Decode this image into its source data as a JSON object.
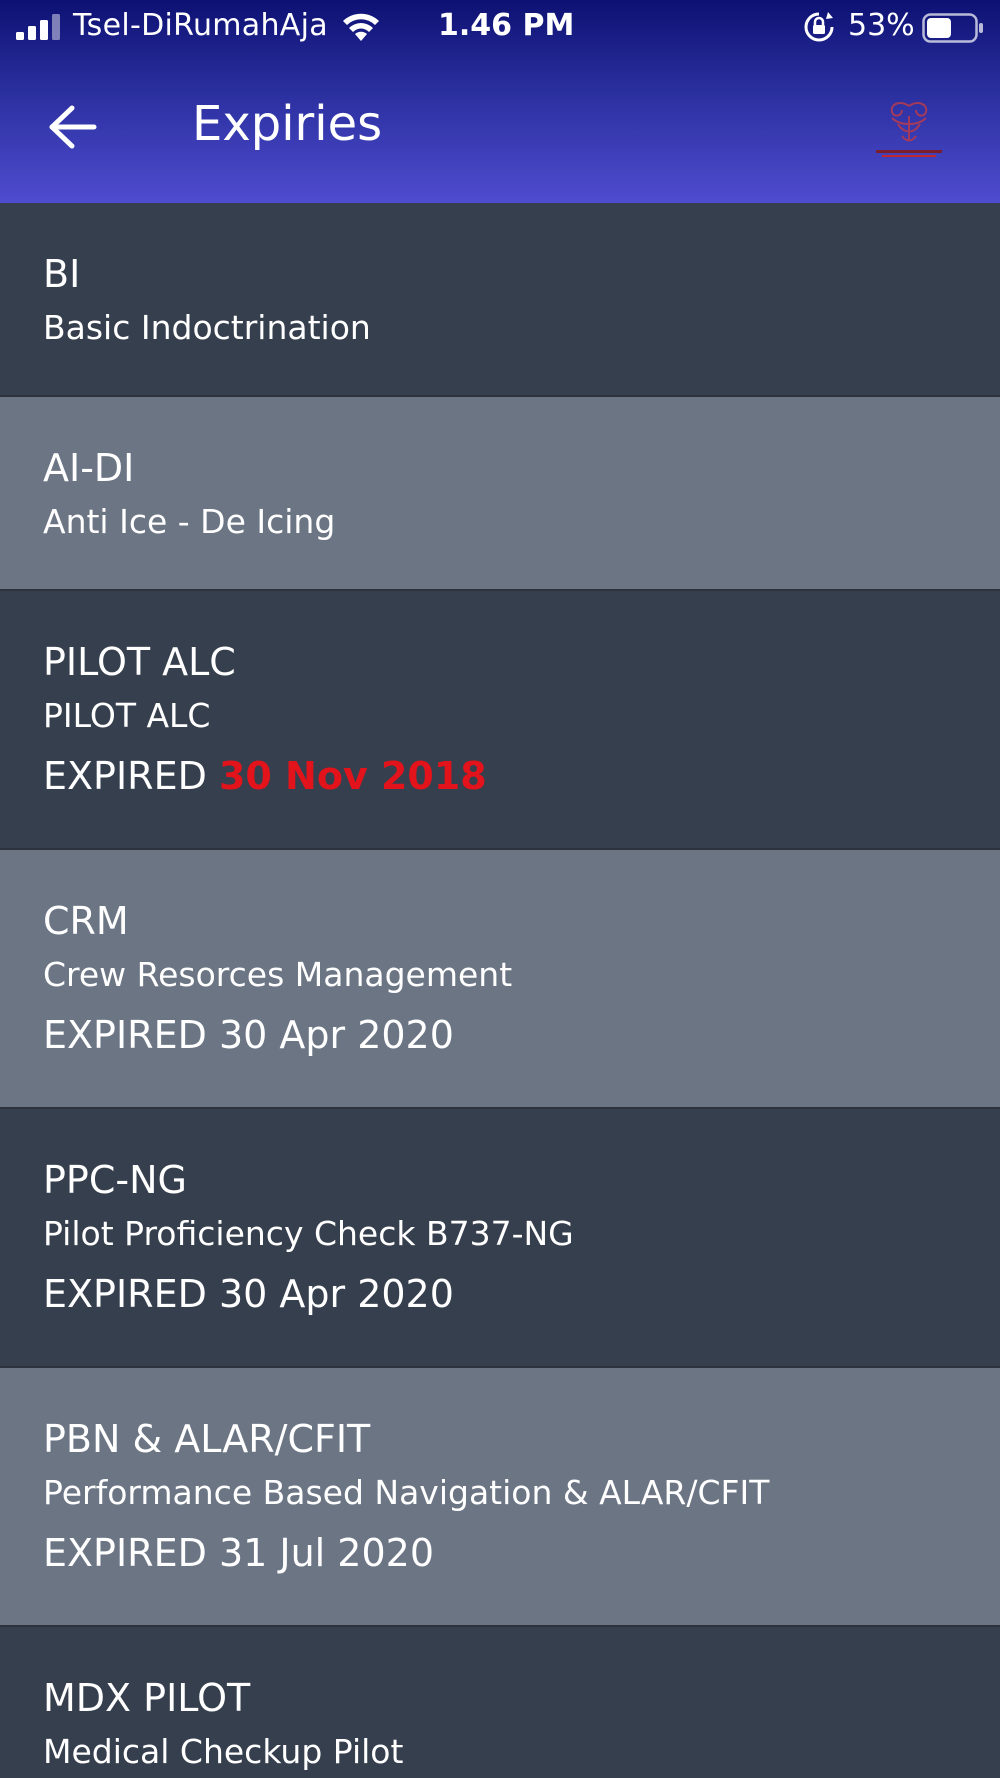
{
  "status_bar": {
    "carrier": "Tsel-DiRumahAja",
    "time": "1.46 PM",
    "battery_percent": "53%",
    "battery_level": 0.53
  },
  "nav": {
    "title": "Expiries",
    "back_icon": "back-arrow-icon",
    "logo_icon": "airline-logo-icon"
  },
  "colors": {
    "header_top": "#0d1173",
    "header_bottom": "#4f4ccf",
    "row_dark": "#363f4d",
    "row_light": "#6b7584",
    "expired_red": "#e3131b"
  },
  "items": [
    {
      "code": "BI",
      "name": "Basic Indoctrination",
      "expired_label": "",
      "expired_date": "",
      "date_color": ""
    },
    {
      "code": "AI-DI",
      "name": "Anti Ice - De Icing",
      "expired_label": "",
      "expired_date": "",
      "date_color": ""
    },
    {
      "code": "PILOT ALC",
      "name": "PILOT ALC",
      "expired_label": "EXPIRED",
      "expired_date": "30 Nov 2018",
      "date_color": "#e3131b"
    },
    {
      "code": "CRM",
      "name": "Crew Resorces Management",
      "expired_label": "EXPIRED",
      "expired_date": "30 Apr 2020",
      "date_color": ""
    },
    {
      "code": "PPC-NG",
      "name": "Pilot Proficiency Check B737-NG",
      "expired_label": "EXPIRED",
      "expired_date": "30 Apr 2020",
      "date_color": ""
    },
    {
      "code": "PBN & ALAR/CFIT",
      "name": "Performance Based Navigation & ALAR/CFIT",
      "expired_label": "EXPIRED",
      "expired_date": "31 Jul 2020",
      "date_color": ""
    },
    {
      "code": "MDX PILOT",
      "name": "Medical Checkup Pilot",
      "expired_label": "",
      "expired_date": "",
      "date_color": ""
    }
  ]
}
